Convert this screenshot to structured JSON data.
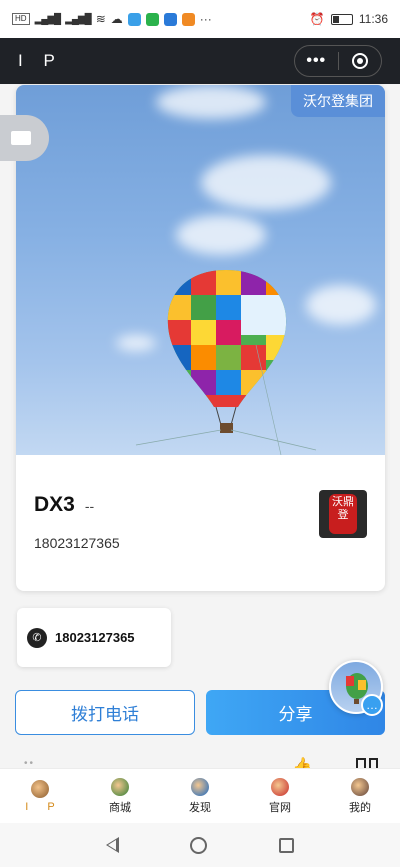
{
  "status_bar": {
    "left_tags": [
      "HD",
      "4G",
      "HD",
      "4G"
    ],
    "time": "11:36"
  },
  "header": {
    "title": "I P"
  },
  "card": {
    "corp_tag": "沃尔登集团",
    "name": "DX3",
    "dash": "--",
    "phone": "18023127365",
    "logo_text": "沃鼎登"
  },
  "phone_chip": {
    "number": "18023127365"
  },
  "actions": {
    "call_label": "拨打电话",
    "share_label": "分享"
  },
  "tabbar": {
    "items": [
      {
        "label": "I P",
        "active": true
      },
      {
        "label": "商城"
      },
      {
        "label": "发现"
      },
      {
        "label": "官网"
      },
      {
        "label": "我的"
      }
    ]
  },
  "colors": {
    "accent": "#2f86e6",
    "active_tab": "#d48a1a",
    "header_bg": "#1f2227"
  }
}
